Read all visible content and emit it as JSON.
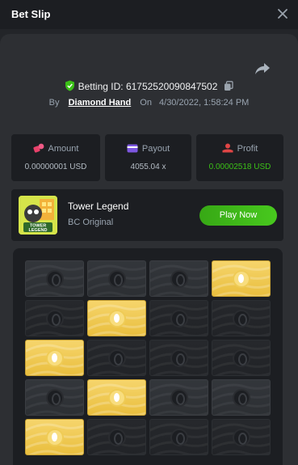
{
  "header": {
    "title": "Bet Slip",
    "close_icon": "close-icon"
  },
  "bet": {
    "id_label": "Betting ID: 61752520090847502",
    "by_label": "By",
    "user": "Diamond Hand",
    "on_label": "On",
    "timestamp": "4/30/2022, 1:58:24 PM"
  },
  "stats": {
    "amount": {
      "label": "Amount",
      "value": "0.00000001 USD",
      "icon": "coins-icon"
    },
    "payout": {
      "label": "Payout",
      "value": "4055.04 x",
      "icon": "wallet-icon"
    },
    "profit": {
      "label": "Profit",
      "value": "0.00002518 USD",
      "icon": "profit-icon",
      "color": "#3bc117"
    }
  },
  "game": {
    "name": "Tower Legend",
    "subtitle": "BC Original",
    "thumb_text": "TOWER LEGEND",
    "play_label": "Play Now"
  },
  "board": {
    "columns": 4,
    "rows": [
      [
        "light",
        "light",
        "light",
        "gold"
      ],
      [
        "dark",
        "gold",
        "dark",
        "dark"
      ],
      [
        "gold",
        "dark",
        "dark",
        "dark"
      ],
      [
        "light",
        "gold",
        "light",
        "light"
      ],
      [
        "gold",
        "dark",
        "dark",
        "dark"
      ]
    ]
  },
  "colors": {
    "accent_green": "#3bc117",
    "gold": "#f0c94a",
    "panel": "#2d2f33"
  }
}
